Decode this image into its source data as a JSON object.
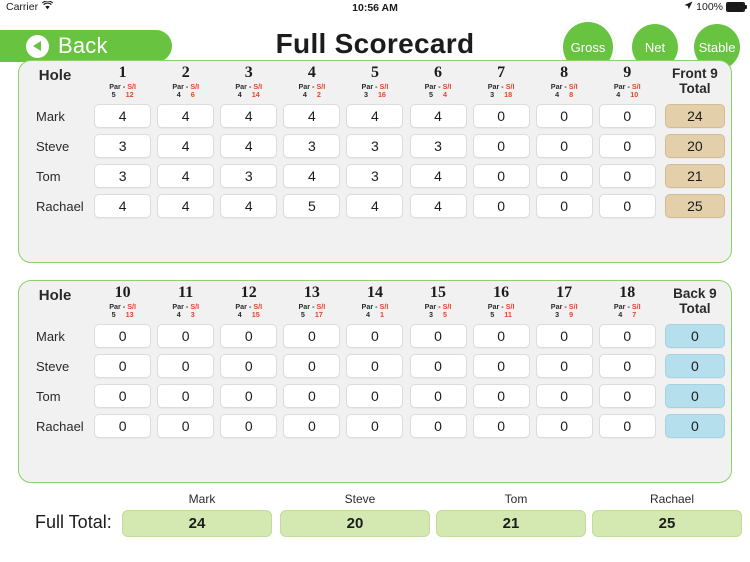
{
  "status_bar": {
    "carrier": "Carrier",
    "wifi_icon": "wifi-icon",
    "time": "10:56 AM",
    "location_icon": "location-arrow-icon",
    "battery_percent": "100%",
    "battery_icon": "battery-icon"
  },
  "nav": {
    "back_label": "Back",
    "back_icon": "chevron-left-circle-icon",
    "title": "Full Scorecard",
    "modes": [
      {
        "label": "Gross",
        "selected": true
      },
      {
        "label": "Net",
        "selected": false
      },
      {
        "label": "Stable",
        "selected": false
      }
    ]
  },
  "colors": {
    "brand_green": "#68c340",
    "card_border": "#8ed06a",
    "card_bg": "#f1f1f1",
    "front_total_bg": "#e4cfab",
    "back_total_bg": "#b5dfec",
    "full_total_bg": "#d4e8b2",
    "si_red": "#e8442b"
  },
  "labels": {
    "hole": "Hole",
    "par": "Par",
    "dash": "-",
    "si": "S/I",
    "front_total_line1": "Front 9",
    "front_total_line2": "Total",
    "back_total_line1": "Back 9",
    "back_total_line2": "Total",
    "full_total": "Full Total:"
  },
  "players": [
    "Mark",
    "Steve",
    "Tom",
    "Rachael"
  ],
  "front_nine": {
    "holes": [
      {
        "number": "1",
        "par": "5",
        "si": "12"
      },
      {
        "number": "2",
        "par": "4",
        "si": "6"
      },
      {
        "number": "3",
        "par": "4",
        "si": "14"
      },
      {
        "number": "4",
        "par": "4",
        "si": "2"
      },
      {
        "number": "5",
        "par": "3",
        "si": "16"
      },
      {
        "number": "6",
        "par": "5",
        "si": "4"
      },
      {
        "number": "7",
        "par": "3",
        "si": "18"
      },
      {
        "number": "8",
        "par": "4",
        "si": "8"
      },
      {
        "number": "9",
        "par": "4",
        "si": "10"
      }
    ],
    "rows": [
      {
        "player": "Mark",
        "scores": [
          "4",
          "4",
          "4",
          "4",
          "4",
          "4",
          "0",
          "0",
          "0"
        ],
        "total": "24"
      },
      {
        "player": "Steve",
        "scores": [
          "3",
          "4",
          "4",
          "3",
          "3",
          "3",
          "0",
          "0",
          "0"
        ],
        "total": "20"
      },
      {
        "player": "Tom",
        "scores": [
          "3",
          "4",
          "3",
          "4",
          "3",
          "4",
          "0",
          "0",
          "0"
        ],
        "total": "21"
      },
      {
        "player": "Rachael",
        "scores": [
          "4",
          "4",
          "4",
          "5",
          "4",
          "4",
          "0",
          "0",
          "0"
        ],
        "total": "25"
      }
    ]
  },
  "back_nine": {
    "holes": [
      {
        "number": "10",
        "par": "5",
        "si": "13"
      },
      {
        "number": "11",
        "par": "4",
        "si": "3"
      },
      {
        "number": "12",
        "par": "4",
        "si": "15"
      },
      {
        "number": "13",
        "par": "5",
        "si": "17"
      },
      {
        "number": "14",
        "par": "4",
        "si": "1"
      },
      {
        "number": "15",
        "par": "3",
        "si": "5"
      },
      {
        "number": "16",
        "par": "5",
        "si": "11"
      },
      {
        "number": "17",
        "par": "3",
        "si": "9"
      },
      {
        "number": "18",
        "par": "4",
        "si": "7"
      }
    ],
    "rows": [
      {
        "player": "Mark",
        "scores": [
          "0",
          "0",
          "0",
          "0",
          "0",
          "0",
          "0",
          "0",
          "0"
        ],
        "total": "0"
      },
      {
        "player": "Steve",
        "scores": [
          "0",
          "0",
          "0",
          "0",
          "0",
          "0",
          "0",
          "0",
          "0"
        ],
        "total": "0"
      },
      {
        "player": "Tom",
        "scores": [
          "0",
          "0",
          "0",
          "0",
          "0",
          "0",
          "0",
          "0",
          "0"
        ],
        "total": "0"
      },
      {
        "player": "Rachael",
        "scores": [
          "0",
          "0",
          "0",
          "0",
          "0",
          "0",
          "0",
          "0",
          "0"
        ],
        "total": "0"
      }
    ]
  },
  "full_total": {
    "label": "Full Total:",
    "entries": [
      {
        "player": "Mark",
        "value": "24"
      },
      {
        "player": "Steve",
        "value": "20"
      },
      {
        "player": "Tom",
        "value": "21"
      },
      {
        "player": "Rachael",
        "value": "25"
      }
    ]
  }
}
